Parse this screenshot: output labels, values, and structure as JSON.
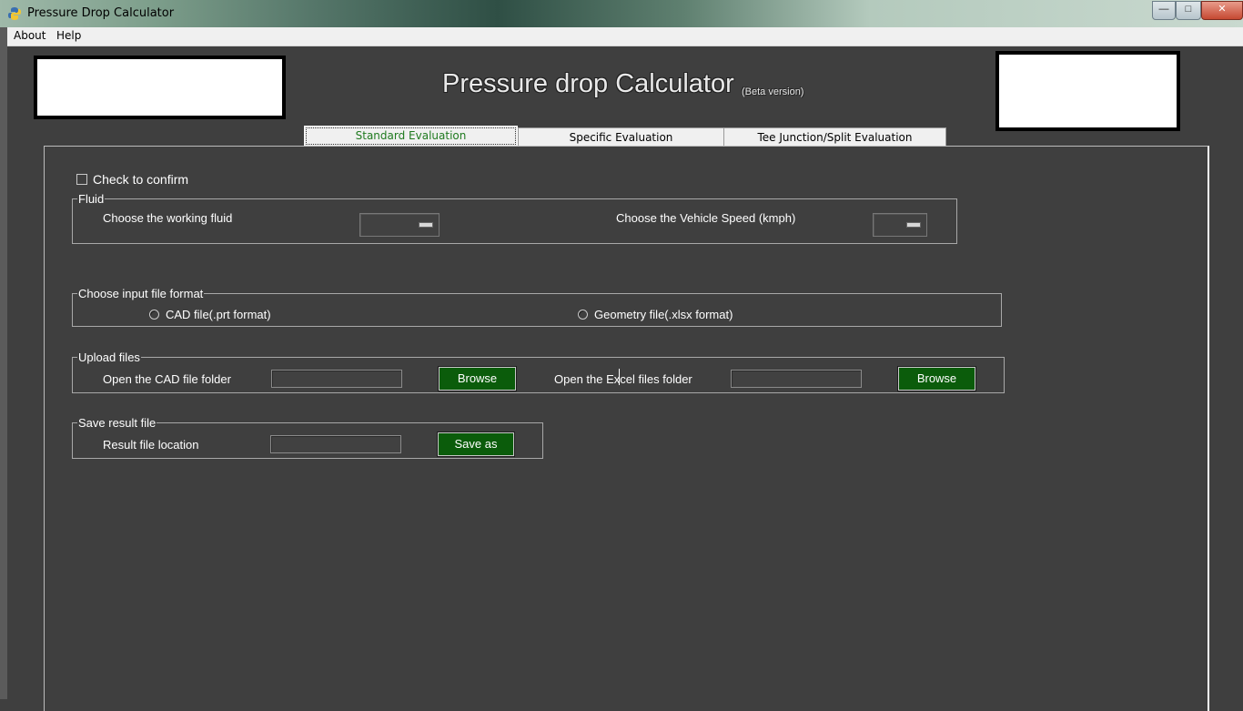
{
  "window": {
    "title": "Pressure Drop Calculator",
    "controls": {
      "minimize": "—",
      "maximize": "□",
      "close": "✕"
    }
  },
  "menu": {
    "items": [
      "About",
      "Help"
    ]
  },
  "header": {
    "title": "Pressure drop Calculator",
    "subtitle": "(Beta version)"
  },
  "tabs": [
    {
      "label": "Standard Evaluation",
      "active": true
    },
    {
      "label": "Specific Evaluation",
      "active": false
    },
    {
      "label": "Tee Junction/Split Evaluation",
      "active": false
    }
  ],
  "confirm": {
    "label": "Check to confirm",
    "checked": false
  },
  "fluid": {
    "group_label": "Fluid",
    "working_fluid_label": "Choose the working fluid",
    "working_fluid_value": "",
    "vehicle_speed_label": "Choose the Vehicle Speed (kmph)",
    "vehicle_speed_value": ""
  },
  "input_format": {
    "group_label": "Choose input file format",
    "option_cad": "CAD file(.prt format)",
    "option_geometry": "Geometry file(.xlsx format)",
    "selected": ""
  },
  "upload": {
    "group_label": "Upload files",
    "cad_label": "Open the CAD file folder",
    "cad_value": "",
    "cad_browse": "Browse",
    "excel_label": "Open the Excel files folder",
    "excel_value": "",
    "excel_browse": "Browse"
  },
  "save": {
    "group_label": "Save result file",
    "location_label": "Result file location",
    "location_value": "",
    "save_button": "Save as"
  },
  "colors": {
    "background": "#3f3f3f",
    "button_green": "#0b5c0b",
    "active_tab_text": "#1f7a1f"
  }
}
